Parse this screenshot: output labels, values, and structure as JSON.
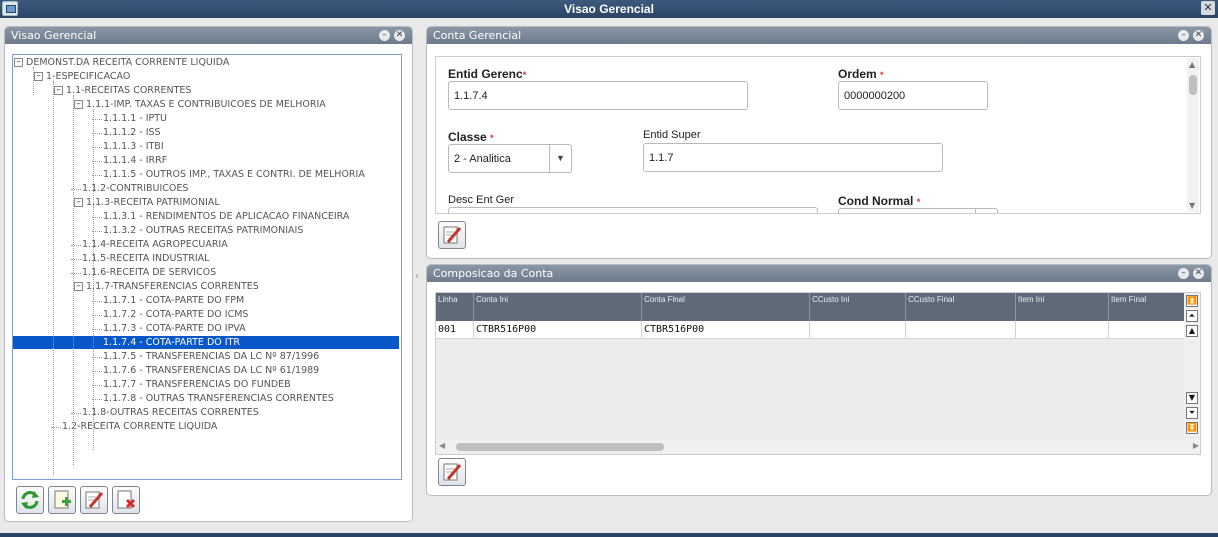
{
  "window": {
    "title": "Visao Gerencial"
  },
  "left_panel": {
    "title": "Visao Gerencial",
    "tree": [
      {
        "label": "DEMONST.DA RECEITA CORRENTE LIQUIDA",
        "level": 0,
        "expander": "minus"
      },
      {
        "label": "1-ESPECIFICACAO",
        "level": 1,
        "expander": "minus"
      },
      {
        "label": "1.1-RECEITAS CORRENTES",
        "level": 2,
        "expander": "minus"
      },
      {
        "label": "1.1.1-IMP. TAXAS E CONTRIBUICOES DE MELHORIA",
        "level": 3,
        "expander": "minus"
      },
      {
        "label": "1.1.1.1 - IPTU",
        "level": 4
      },
      {
        "label": "1.1.1.2 - ISS",
        "level": 4
      },
      {
        "label": "1.1.1.3 - ITBI",
        "level": 4
      },
      {
        "label": "1.1.1.4 - IRRF",
        "level": 4
      },
      {
        "label": "1.1.1.5 - OUTROS IMP., TAXAS E CONTRI. DE MELHORIA",
        "level": 4
      },
      {
        "label": "1.1.2-CONTRIBUICOES",
        "level": 3
      },
      {
        "label": "1.1.3-RECEITA PATRIMONIAL",
        "level": 3,
        "expander": "minus"
      },
      {
        "label": "1.1.3.1 - RENDIMENTOS DE APLICACAO FINANCEIRA",
        "level": 4
      },
      {
        "label": "1.1.3.2 - OUTRAS RECEITAS PATRIMONIAIS",
        "level": 4
      },
      {
        "label": "1.1.4-RECEITA AGROPECUARIA",
        "level": 3
      },
      {
        "label": "1.1.5-RECEITA INDUSTRIAL",
        "level": 3
      },
      {
        "label": "1.1.6-RECEITA DE SERVICOS",
        "level": 3
      },
      {
        "label": "1.1.7-TRANSFERENCIAS CORRENTES",
        "level": 3,
        "expander": "minus"
      },
      {
        "label": "1.1.7.1 - COTA-PARTE DO FPM",
        "level": 4
      },
      {
        "label": "1.1.7.2 - COTA-PARTE DO ICMS",
        "level": 4
      },
      {
        "label": "1.1.7.3 - COTA-PARTE DO IPVA",
        "level": 4
      },
      {
        "label": "1.1.7.4 - COTA-PARTE DO ITR",
        "level": 4,
        "selected": true
      },
      {
        "label": "1.1.7.5 - TRANSFERENCIAS DA LC Nº 87/1996",
        "level": 4
      },
      {
        "label": "1.1.7.6 - TRANSFERENCIAS DA LC Nº 61/1989",
        "level": 4
      },
      {
        "label": "1.1.7.7 - TRANSFERENCIAS DO FUNDEB",
        "level": 4
      },
      {
        "label": "1.1.7.8 - OUTRAS TRANSFERENCIAS CORRENTES",
        "level": 4
      },
      {
        "label": "1.1.8-OUTRAS RECEITAS CORRENTES",
        "level": 3
      },
      {
        "label": "1.2-RECEITA CORRENTE LIQUIDA",
        "level": 2
      }
    ],
    "buttons": [
      "refresh-icon",
      "add-icon",
      "edit-icon",
      "delete-icon"
    ]
  },
  "conta_panel": {
    "title": "Conta Gerencial",
    "fields": {
      "entid_gerenc_label": "Entid Gerenc",
      "entid_gerenc_value": "1.1.7.4",
      "ordem_label": "Ordem",
      "ordem_value": "0000000200",
      "classe_label": "Classe",
      "classe_value": "2 - Analitica",
      "entid_super_label": "Entid Super",
      "entid_super_value": "1.1.7",
      "desc_label": "Desc Ent Ger",
      "cond_normal_label": "Cond Normal"
    },
    "required_marker": "*"
  },
  "composicao_panel": {
    "title": "Composicao da Conta",
    "columns": [
      "Linha",
      "Conta Ini",
      "Conta Final",
      "CCusto Ini",
      "CCusto Final",
      "Item Ini",
      "Item Final"
    ],
    "rows": [
      [
        "001",
        "CTBR516P00",
        "CTBR516P00",
        "",
        "",
        "",
        ""
      ]
    ]
  },
  "colors": {
    "titlebar": "#2b4466",
    "panel_header": "#7a8898",
    "selection": "#0a57c9",
    "grid_header": "#5e6a78"
  }
}
